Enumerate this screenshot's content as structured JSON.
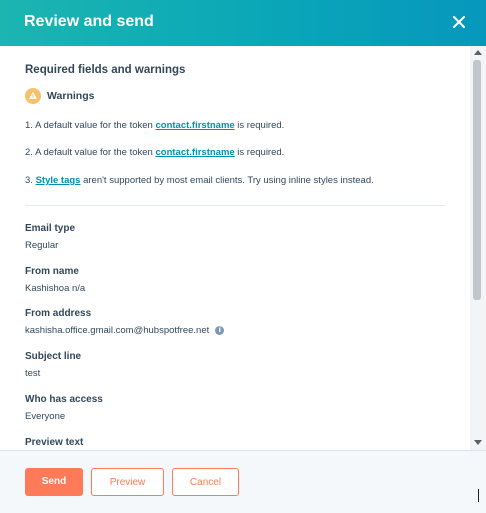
{
  "header": {
    "title": "Review and send"
  },
  "section": {
    "title": "Required fields and warnings",
    "warnings_label": "Warnings",
    "items": [
      {
        "number": "1.",
        "before": "A default value for the token ",
        "link": "contact.firstname",
        "after": " is required."
      },
      {
        "number": "2.",
        "before": "A default value for the token ",
        "link": "contact.firstname",
        "after": " is required."
      },
      {
        "number": "3.",
        "before": "",
        "link": "Style tags",
        "after": " aren't supported by most email clients. Try using inline styles instead."
      }
    ]
  },
  "details": {
    "email_type": {
      "label": "Email type",
      "value": "Regular"
    },
    "from_name": {
      "label": "From name",
      "value": "Kashishoa n/a"
    },
    "from_address": {
      "label": "From address",
      "value": "kashisha.office.gmail.com@hubspotfree.net"
    },
    "subject_line": {
      "label": "Subject line",
      "value": "test"
    },
    "who_has_access": {
      "label": "Who has access",
      "value": "Everyone"
    },
    "preview_text": {
      "label": "Preview text"
    }
  },
  "footer": {
    "send": "Send",
    "preview": "Preview",
    "cancel": "Cancel"
  },
  "colors": {
    "header_start": "#1cb5b0",
    "header_end": "#0797bd",
    "accent": "#ff7a59",
    "link": "#0091ae",
    "text": "#33475b",
    "warning": "#f5c26b"
  }
}
